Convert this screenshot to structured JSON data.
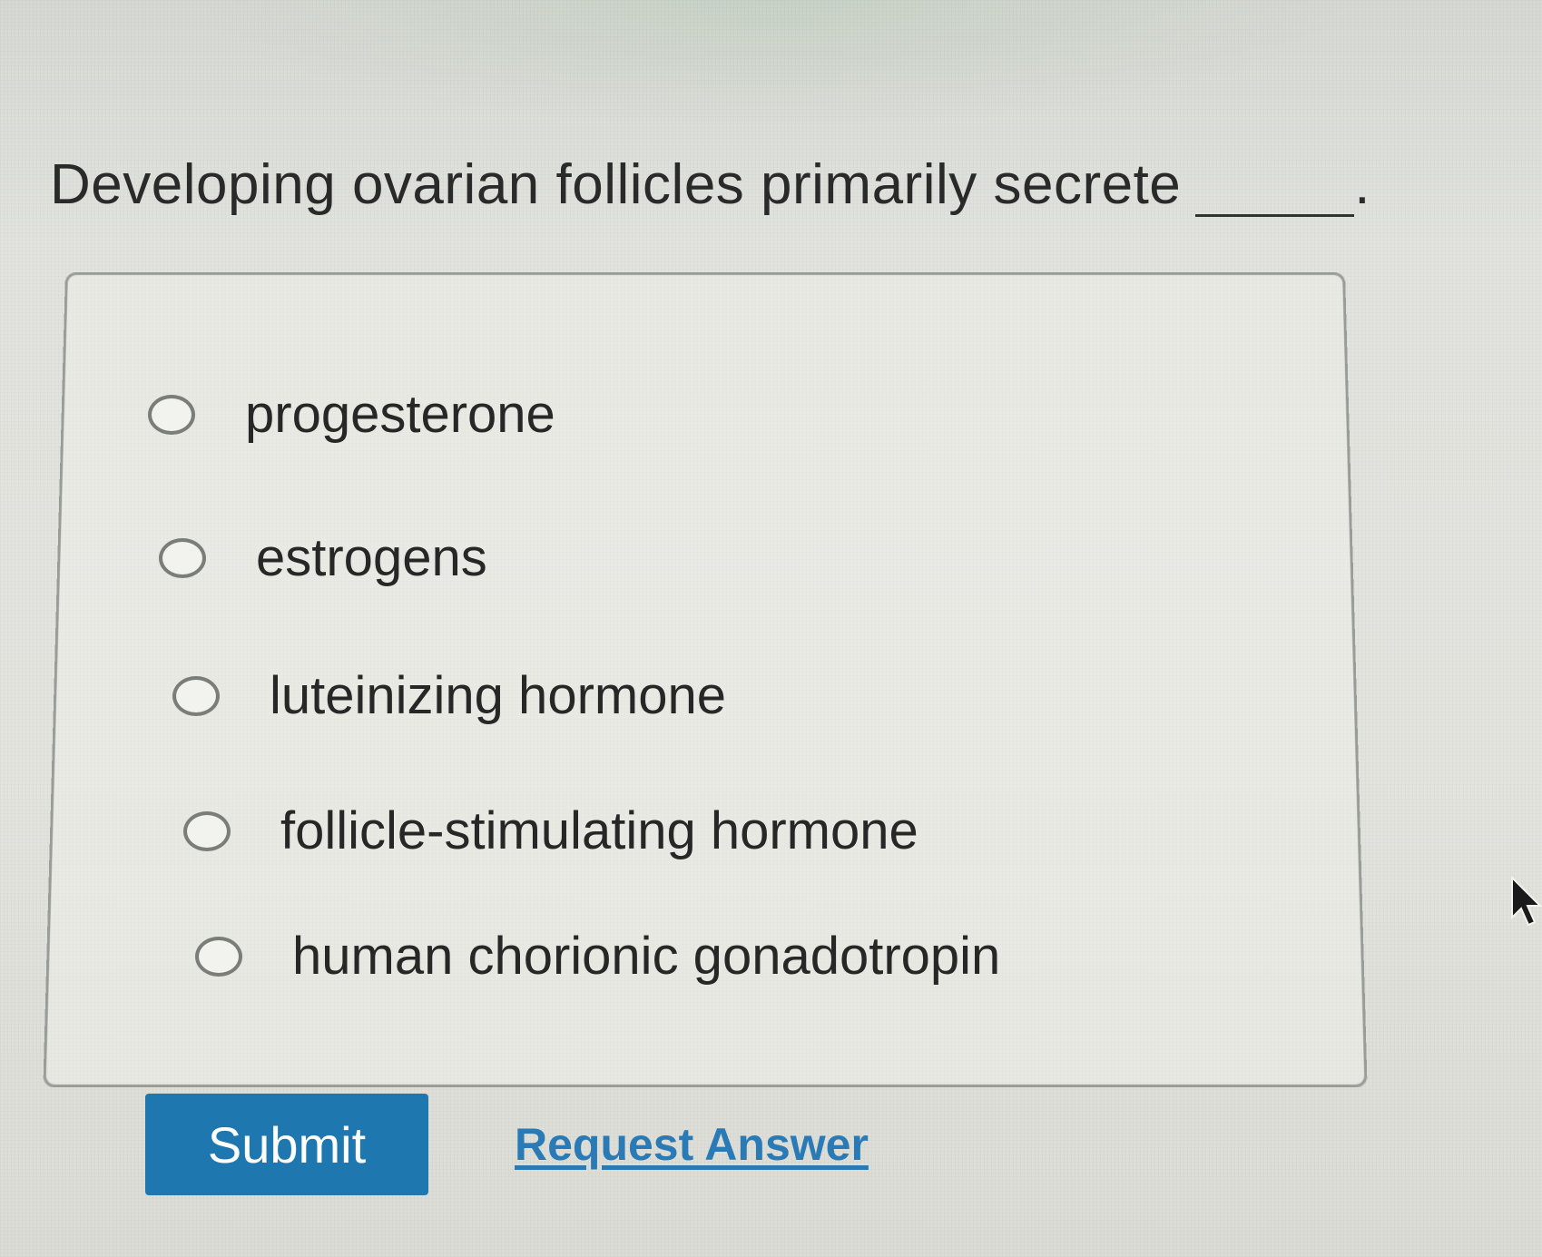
{
  "question": {
    "text": "Developing ovarian follicles primarily secrete",
    "suffix": "."
  },
  "options": [
    {
      "label": "progesterone",
      "selected": false
    },
    {
      "label": "estrogens",
      "selected": false
    },
    {
      "label": "luteinizing hormone",
      "selected": false
    },
    {
      "label": "follicle-stimulating hormone",
      "selected": false
    },
    {
      "label": "human chorionic gonadotropin",
      "selected": false
    }
  ],
  "actions": {
    "submit_label": "Submit",
    "request_answer_label": "Request Answer"
  },
  "colors": {
    "submit_background": "#1f77b0",
    "link": "#2a7ab5"
  },
  "icons": {
    "pointer": "mouse-pointer-icon"
  }
}
